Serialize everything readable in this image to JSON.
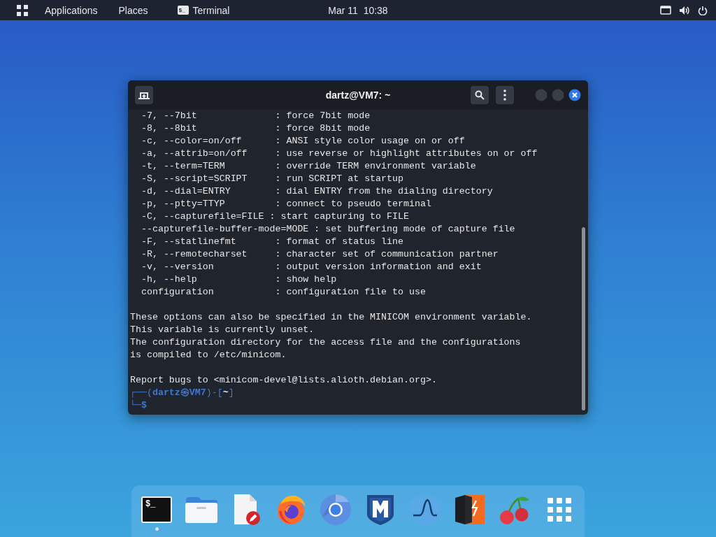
{
  "top_bar": {
    "menus": [
      {
        "label": "Applications"
      },
      {
        "label": "Places"
      }
    ],
    "app": {
      "icon_text": "$_",
      "label": "Terminal"
    },
    "clock": "Mar 11  10:38"
  },
  "window": {
    "title": "dartz@VM7: ~",
    "lines": [
      {
        "kind": "text",
        "text": "  -7, --7bit              : force 7bit mode"
      },
      {
        "kind": "text",
        "text": "  -8, --8bit              : force 8bit mode"
      },
      {
        "kind": "text",
        "text": "  -c, --color=on/off      : ANSI style color usage on or off"
      },
      {
        "kind": "text",
        "text": "  -a, --attrib=on/off     : use reverse or highlight attributes on or off"
      },
      {
        "kind": "text",
        "text": "  -t, --term=TERM         : override TERM environment variable"
      },
      {
        "kind": "text",
        "text": "  -S, --script=SCRIPT     : run SCRIPT at startup"
      },
      {
        "kind": "text",
        "text": "  -d, --dial=ENTRY        : dial ENTRY from the dialing directory"
      },
      {
        "kind": "text",
        "text": "  -p, --ptty=TTYP         : connect to pseudo terminal"
      },
      {
        "kind": "text",
        "text": "  -C, --capturefile=FILE : start capturing to FILE"
      },
      {
        "kind": "text",
        "text": "  --capturefile-buffer-mode=MODE : set buffering mode of capture file"
      },
      {
        "kind": "text",
        "text": "  -F, --statlinefmt       : format of status line"
      },
      {
        "kind": "text",
        "text": "  -R, --remotecharset     : character set of communication partner"
      },
      {
        "kind": "text",
        "text": "  -v, --version           : output version information and exit"
      },
      {
        "kind": "text",
        "text": "  -h, --help              : show help"
      },
      {
        "kind": "text",
        "text": "  configuration           : configuration file to use"
      },
      {
        "kind": "blank"
      },
      {
        "kind": "text",
        "text": "These options can also be specified in the MINICOM environment variable."
      },
      {
        "kind": "text",
        "text": "This variable is currently unset."
      },
      {
        "kind": "text",
        "text": "The configuration directory for the access file and the configurations"
      },
      {
        "kind": "text",
        "text": "is compiled to /etc/minicom."
      },
      {
        "kind": "blank"
      },
      {
        "kind": "text",
        "text": "Report bugs to <minicom-devel@lists.alioth.debian.org>."
      }
    ],
    "prompt": {
      "open": "┌──(",
      "user": "dartz",
      "at": "㉿",
      "host": "VM7",
      "mid": ")-[",
      "dir": "~",
      "close": "]",
      "corner": "└─",
      "symbol": "$"
    }
  },
  "dock": {
    "items": [
      {
        "kind": "terminal",
        "icon_text": "$_",
        "running": true
      },
      {
        "kind": "files",
        "running": false
      },
      {
        "kind": "editor",
        "running": false
      },
      {
        "kind": "fox",
        "running": false
      },
      {
        "kind": "ring",
        "running": false
      },
      {
        "kind": "shield",
        "running": false
      },
      {
        "kind": "fin",
        "running": false
      },
      {
        "kind": "bolt",
        "running": false
      },
      {
        "kind": "cherry",
        "running": false
      },
      {
        "kind": "apps",
        "running": false
      }
    ]
  }
}
